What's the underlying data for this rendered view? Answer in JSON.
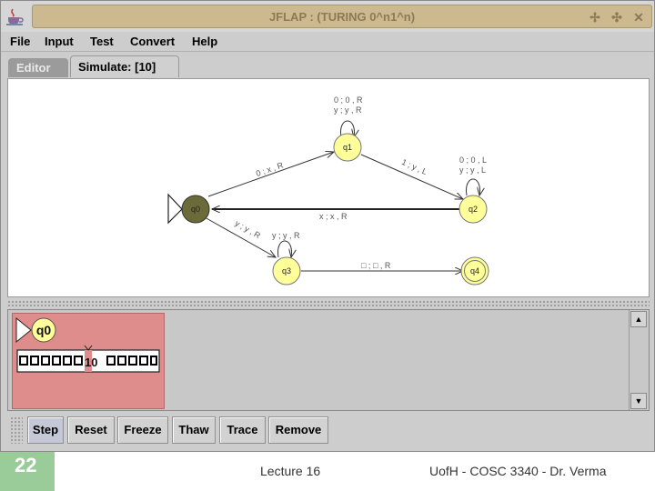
{
  "window": {
    "title": "JFLAP : (TURING 0^n1^n)",
    "controls": [
      "minimize-icon",
      "maximize-icon",
      "close-icon"
    ]
  },
  "menu": {
    "items": [
      {
        "label": "File"
      },
      {
        "label": "Input"
      },
      {
        "label": "Test"
      },
      {
        "label": "Convert"
      },
      {
        "label": "Help"
      }
    ]
  },
  "tabs": [
    {
      "label": "Editor",
      "active": false
    },
    {
      "label": "Simulate: [10]",
      "active": true
    }
  ],
  "automaton": {
    "states": [
      {
        "id": "q0",
        "label": "q0",
        "initial": true,
        "final": false,
        "highlighted": true
      },
      {
        "id": "q1",
        "label": "q1",
        "initial": false,
        "final": false,
        "highlighted": false
      },
      {
        "id": "q2",
        "label": "q2",
        "initial": false,
        "final": false,
        "highlighted": false
      },
      {
        "id": "q3",
        "label": "q3",
        "initial": false,
        "final": false,
        "highlighted": false
      },
      {
        "id": "q4",
        "label": "q4",
        "initial": false,
        "final": true,
        "highlighted": false
      }
    ],
    "transitions": [
      {
        "from": "q0",
        "to": "q1",
        "label": "0 ; x , R"
      },
      {
        "from": "q1",
        "to": "q1",
        "labels": [
          "0 ; 0 , R",
          "y ; y , R"
        ]
      },
      {
        "from": "q1",
        "to": "q2",
        "label": "1 ; y , L"
      },
      {
        "from": "q2",
        "to": "q2",
        "labels": [
          "0 ; 0 , L",
          "y ; y , L"
        ]
      },
      {
        "from": "q2",
        "to": "q0",
        "label": "x ; x , R"
      },
      {
        "from": "q0",
        "to": "q3",
        "label": "y ; y , R"
      },
      {
        "from": "q3",
        "to": "q3",
        "label": "y ; y , R"
      },
      {
        "from": "q3",
        "to": "q4",
        "label": "□ ; □ , R"
      }
    ],
    "colors": {
      "state_fill": "#ffff99",
      "highlight_fill": "#6b6b3a",
      "edge": "#333333"
    }
  },
  "simulation": {
    "configuration": {
      "state": "q0",
      "tape": "10",
      "head_index": 0,
      "card_color": "#de8c8c"
    }
  },
  "toolbar": {
    "buttons": [
      {
        "label": "Step",
        "active": true
      },
      {
        "label": "Reset"
      },
      {
        "label": "Freeze"
      },
      {
        "label": "Thaw"
      },
      {
        "label": "Trace"
      },
      {
        "label": "Remove"
      }
    ]
  },
  "footer": {
    "slide_number": "22",
    "center": "Lecture 16",
    "right": "UofH - COSC 3340 - Dr. Verma"
  }
}
